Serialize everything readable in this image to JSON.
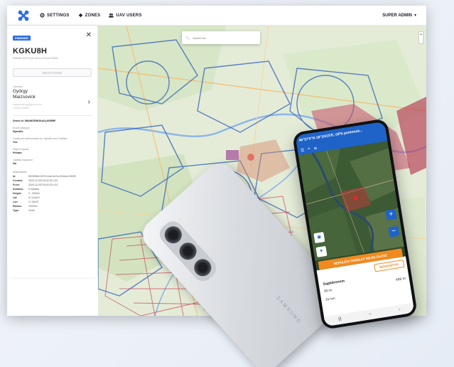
{
  "topbar": {
    "nav": [
      {
        "label": "SETTINGS",
        "icon": "gear-icon"
      },
      {
        "label": "ZONES",
        "icon": "zones-icon"
      },
      {
        "label": "UAV USERS",
        "icon": "users-icon"
      }
    ],
    "user_menu": "SUPER ADMIN"
  },
  "panel": {
    "badge": "FINISHED",
    "flight_id": "KGKU8H",
    "flight_uuid": "9089f64-0075-11eb-bd7a-0242ac120005",
    "deactivate_label": "DEACTIVATE",
    "operator_label": "Operator",
    "operator_first": "György",
    "operator_last": "Maizsovick",
    "operator_email": "maizsovick.gy@gmail.com",
    "operator_phone": "+36301234567",
    "drone_id_label": "Drone Id:",
    "drone_id_value": "9864NZEWOKaCy1695BP",
    "fields": [
      {
        "label": "Drone category",
        "value": "Specific"
      },
      {
        "label": "Confirmed Authorization for Specific and Certified",
        "value": "Yes"
      },
      {
        "label": "Flight Purpose",
        "value": "Private"
      },
      {
        "label": "Liability Insurance",
        "value": "No"
      }
    ],
    "details_title": "detail details",
    "details": [
      {
        "k": "Id:",
        "v": "50009964-0075-11eb-bd7a-0242ac120005"
      },
      {
        "k": "Created:",
        "v": "2020-12-03T15:42:33 LOC"
      },
      {
        "k": "From:",
        "v": "2020-12-03T15:42:33 LOC"
      },
      {
        "k": "Duration:",
        "v": "5 minutes"
      },
      {
        "k": "Height:",
        "v": "0 - 2000m"
      },
      {
        "k": "Lat:",
        "v": "47.114617"
      },
      {
        "k": "Lon:",
        "v": "17.30207"
      },
      {
        "k": "Radius:",
        "v": "10000m"
      },
      {
        "k": "Type:",
        "v": "Circle"
      }
    ]
  },
  "map": {
    "search_placeholder": "Search for...",
    "zoom_in": "+"
  },
  "phone": {
    "coords": "46°37'0\"N 18°1h/15'E, GPS pontossá...",
    "zoom_in": "+",
    "zoom_out": "−",
    "orange_button": "REPÜLÉSI TERÜLET MEJELÖLÉSE",
    "outline_button": "MÓDOSÍTÁS",
    "sheet_title": "Sajátdronom",
    "distance": "90 m",
    "altitude": "499 m",
    "time": "20 min",
    "brand": "SAMSUNG"
  }
}
